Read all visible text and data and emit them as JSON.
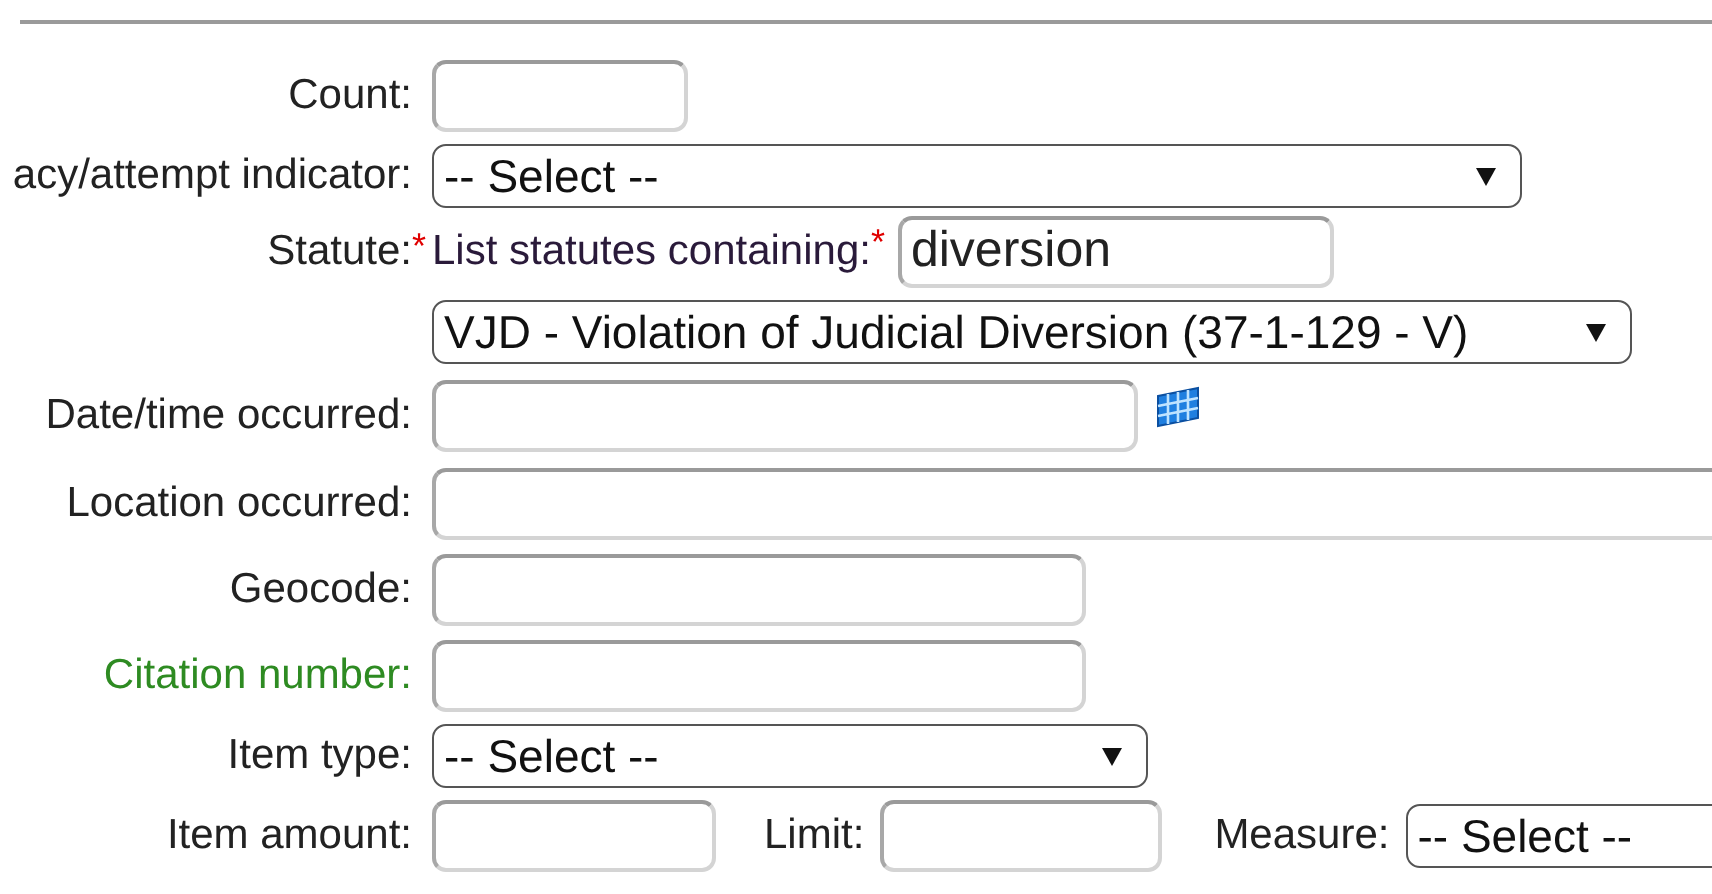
{
  "rows": [
    {
      "kind": "input",
      "label": "Count:"
    },
    {
      "kind": "select",
      "label": "acy/attempt indicator:",
      "value": "-- Select --"
    },
    {
      "kind": "search",
      "label": "Statute:",
      "mark": "*",
      "search_label": "List statutes containing:",
      "search_mark": "*",
      "value": "diversion"
    },
    {
      "kind": "select",
      "value": "VJD - Violation of Judicial Diversion (37-1-129 - V)"
    },
    {
      "kind": "date",
      "label": "Date/time occurred:"
    },
    {
      "kind": "input",
      "label": "Location occurred:"
    },
    {
      "kind": "input",
      "label": "Geocode:"
    },
    {
      "kind": "input",
      "label": "Citation number:",
      "color": "#2e8b22"
    },
    {
      "kind": "select",
      "label": "Item type:",
      "value": "-- Select --"
    },
    {
      "kind": "input",
      "label": "Item amount:",
      "extras": [
        {
          "kind": "input",
          "label": "Limit:"
        },
        {
          "kind": "select",
          "label": "Measure:",
          "value": "-- Select --"
        }
      ]
    }
  ]
}
